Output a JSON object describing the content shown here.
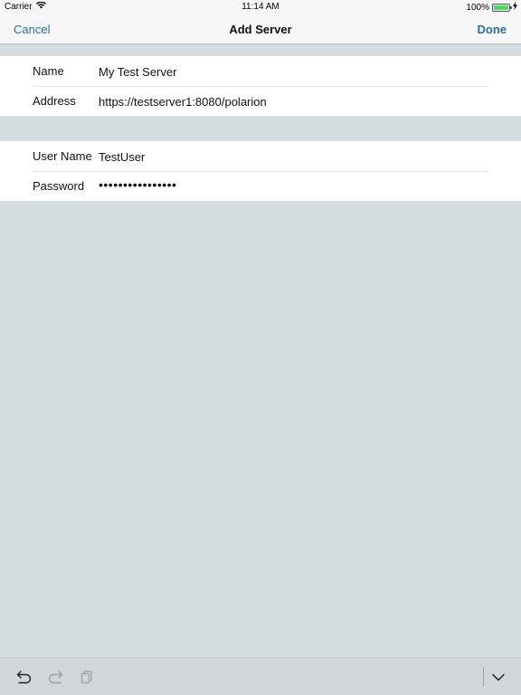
{
  "status_bar": {
    "carrier": "Carrier",
    "time": "11:14 AM",
    "battery": "100%"
  },
  "nav": {
    "cancel_label": "Cancel",
    "title": "Add Server",
    "done_label": "Done"
  },
  "server_group": {
    "name_label": "Name",
    "name_value": "My Test Server",
    "address_label": "Address",
    "address_value": "https://testserver1:8080/polarion"
  },
  "credentials_group": {
    "username_label": "User Name",
    "username_value": "TestUser",
    "password_label": "Password",
    "password_value": "••••••••••••••••"
  },
  "toolbar": {
    "undo_icon": "undo-icon",
    "redo_icon": "redo-icon",
    "paste_icon": "paste-icon",
    "dismiss_icon": "keyboard-dismiss-icon"
  },
  "colors": {
    "accent": "#2a6e9e",
    "background": "#d6dde1",
    "battery": "#4cd964"
  }
}
